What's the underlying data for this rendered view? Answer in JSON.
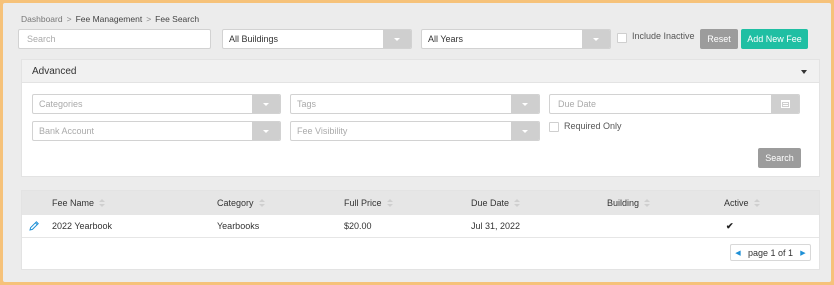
{
  "breadcrumb": {
    "items": [
      "Dashboard",
      "Fee Management",
      "Fee Search"
    ],
    "separator": ">"
  },
  "filters": {
    "search_placeholder": "Search",
    "building": "All Buildings",
    "year": "All Years",
    "include_inactive_label": "Include Inactive",
    "include_inactive_checked": false,
    "reset_label": "Reset",
    "add_new_label": "Add New Fee"
  },
  "advanced": {
    "title": "Advanced",
    "categories_placeholder": "Categories",
    "tags_placeholder": "Tags",
    "due_date_placeholder": "Due Date",
    "bank_account_placeholder": "Bank Account",
    "fee_visibility_placeholder": "Fee Visibility",
    "required_only_label": "Required Only",
    "required_only_checked": false,
    "search_label": "Search"
  },
  "table": {
    "columns": [
      "Fee Name",
      "Category",
      "Full Price",
      "Due Date",
      "Building",
      "Active"
    ],
    "rows": [
      {
        "fee_name": "2022 Yearbook",
        "category": "Yearbooks",
        "full_price": "$20.00",
        "due_date": "Jul 31, 2022",
        "building": "",
        "active": "✔"
      }
    ],
    "pager_text": "page 1 of 1"
  },
  "colors": {
    "accent": "#1fbfa3",
    "reset": "#9c9c9c",
    "link": "#1e90d6",
    "frame": "#f6c27a"
  }
}
